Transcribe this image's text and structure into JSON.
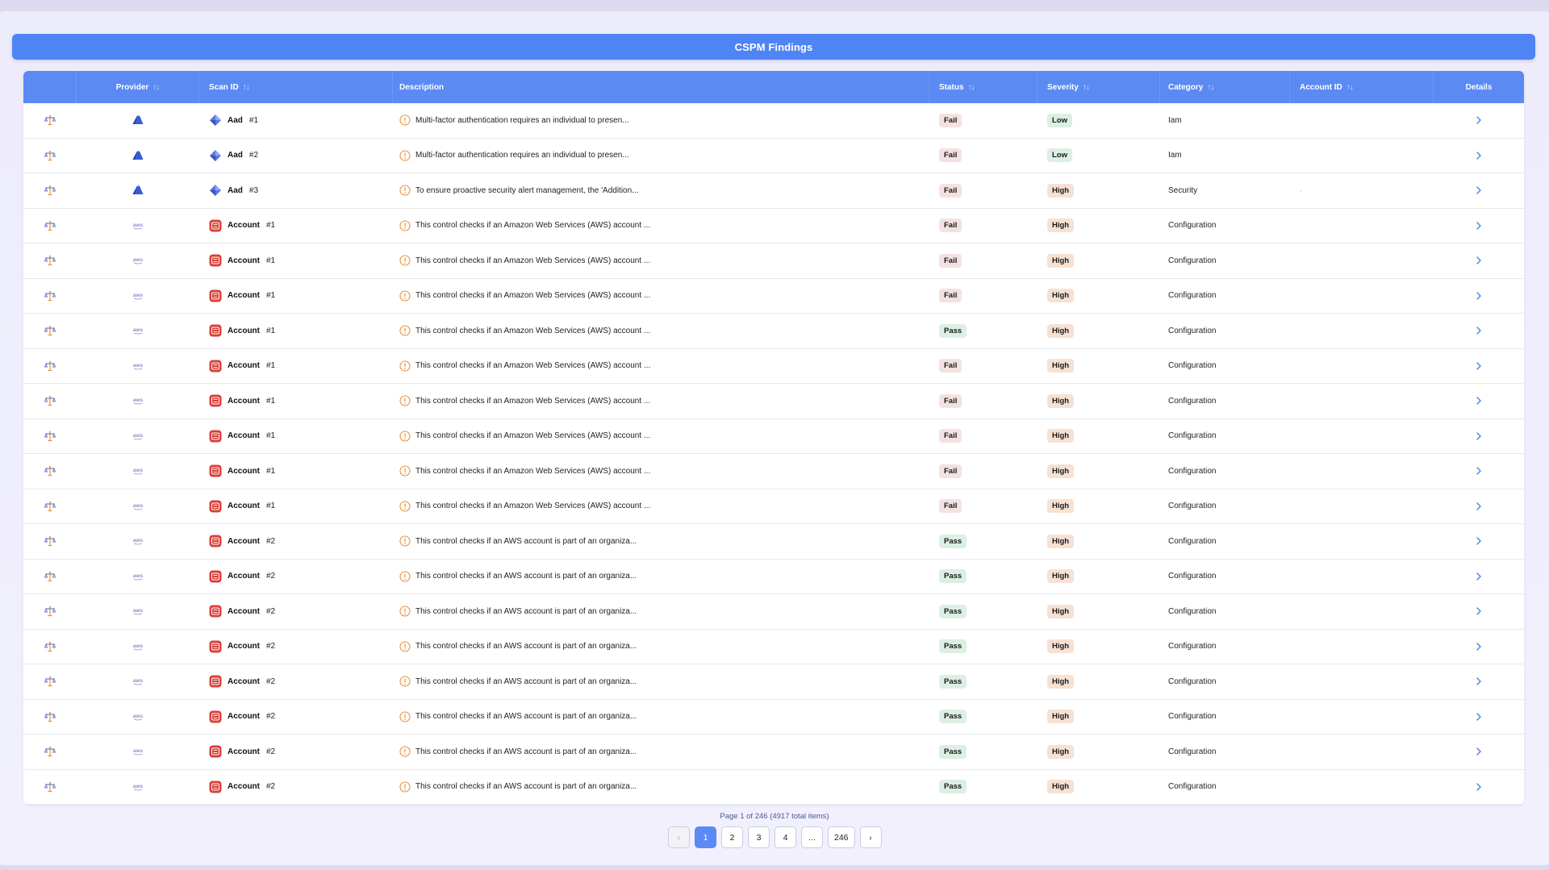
{
  "title": "CSPM Findings",
  "columns": {
    "provider": "Provider",
    "scan_id": "Scan ID",
    "description": "Description",
    "status": "Status",
    "severity": "Severity",
    "category": "Category",
    "account_id": "Account ID",
    "details": "Details"
  },
  "rows": [
    {
      "provider": "azure",
      "scan_icon": "azure",
      "scan_name": "Aad",
      "scan_num": "#1",
      "description": "Multi-factor authentication requires an individual to presen...",
      "status": "Fail",
      "severity": "Low",
      "category": "Iam",
      "account_id": ""
    },
    {
      "provider": "azure",
      "scan_icon": "azure",
      "scan_name": "Aad",
      "scan_num": "#2",
      "description": "Multi-factor authentication requires an individual to presen...",
      "status": "Fail",
      "severity": "Low",
      "category": "Iam",
      "account_id": ""
    },
    {
      "provider": "azure",
      "scan_icon": "azure",
      "scan_name": "Aad",
      "scan_num": "#3",
      "description": "To ensure proactive security alert management, the 'Addition...",
      "status": "Fail",
      "severity": "High",
      "category": "Security",
      "account_id": "-"
    },
    {
      "provider": "aws",
      "scan_icon": "aws",
      "scan_name": "Account",
      "scan_num": "#1",
      "description": "This control checks if an Amazon Web Services (AWS) account ...",
      "status": "Fail",
      "severity": "High",
      "category": "Configuration",
      "account_id": ""
    },
    {
      "provider": "aws",
      "scan_icon": "aws",
      "scan_name": "Account",
      "scan_num": "#1",
      "description": "This control checks if an Amazon Web Services (AWS) account ...",
      "status": "Fail",
      "severity": "High",
      "category": "Configuration",
      "account_id": ""
    },
    {
      "provider": "aws",
      "scan_icon": "aws",
      "scan_name": "Account",
      "scan_num": "#1",
      "description": "This control checks if an Amazon Web Services (AWS) account ...",
      "status": "Fail",
      "severity": "High",
      "category": "Configuration",
      "account_id": ""
    },
    {
      "provider": "aws",
      "scan_icon": "aws",
      "scan_name": "Account",
      "scan_num": "#1",
      "description": "This control checks if an Amazon Web Services (AWS) account ...",
      "status": "Pass",
      "severity": "High",
      "category": "Configuration",
      "account_id": ""
    },
    {
      "provider": "aws",
      "scan_icon": "aws",
      "scan_name": "Account",
      "scan_num": "#1",
      "description": "This control checks if an Amazon Web Services (AWS) account ...",
      "status": "Fail",
      "severity": "High",
      "category": "Configuration",
      "account_id": ""
    },
    {
      "provider": "aws",
      "scan_icon": "aws",
      "scan_name": "Account",
      "scan_num": "#1",
      "description": "This control checks if an Amazon Web Services (AWS) account ...",
      "status": "Fail",
      "severity": "High",
      "category": "Configuration",
      "account_id": ""
    },
    {
      "provider": "aws",
      "scan_icon": "aws",
      "scan_name": "Account",
      "scan_num": "#1",
      "description": "This control checks if an Amazon Web Services (AWS) account ...",
      "status": "Fail",
      "severity": "High",
      "category": "Configuration",
      "account_id": ""
    },
    {
      "provider": "aws",
      "scan_icon": "aws",
      "scan_name": "Account",
      "scan_num": "#1",
      "description": "This control checks if an Amazon Web Services (AWS) account ...",
      "status": "Fail",
      "severity": "High",
      "category": "Configuration",
      "account_id": ""
    },
    {
      "provider": "aws",
      "scan_icon": "aws",
      "scan_name": "Account",
      "scan_num": "#1",
      "description": "This control checks if an Amazon Web Services (AWS) account ...",
      "status": "Fail",
      "severity": "High",
      "category": "Configuration",
      "account_id": ""
    },
    {
      "provider": "aws",
      "scan_icon": "aws",
      "scan_name": "Account",
      "scan_num": "#2",
      "description": "This control checks if an AWS account is part of an organiza...",
      "status": "Pass",
      "severity": "High",
      "category": "Configuration",
      "account_id": ""
    },
    {
      "provider": "aws",
      "scan_icon": "aws",
      "scan_name": "Account",
      "scan_num": "#2",
      "description": "This control checks if an AWS account is part of an organiza...",
      "status": "Pass",
      "severity": "High",
      "category": "Configuration",
      "account_id": ""
    },
    {
      "provider": "aws",
      "scan_icon": "aws",
      "scan_name": "Account",
      "scan_num": "#2",
      "description": "This control checks if an AWS account is part of an organiza...",
      "status": "Pass",
      "severity": "High",
      "category": "Configuration",
      "account_id": ""
    },
    {
      "provider": "aws",
      "scan_icon": "aws",
      "scan_name": "Account",
      "scan_num": "#2",
      "description": "This control checks if an AWS account is part of an organiza...",
      "status": "Pass",
      "severity": "High",
      "category": "Configuration",
      "account_id": ""
    },
    {
      "provider": "aws",
      "scan_icon": "aws",
      "scan_name": "Account",
      "scan_num": "#2",
      "description": "This control checks if an AWS account is part of an organiza...",
      "status": "Pass",
      "severity": "High",
      "category": "Configuration",
      "account_id": ""
    },
    {
      "provider": "aws",
      "scan_icon": "aws",
      "scan_name": "Account",
      "scan_num": "#2",
      "description": "This control checks if an AWS account is part of an organiza...",
      "status": "Pass",
      "severity": "High",
      "category": "Configuration",
      "account_id": ""
    },
    {
      "provider": "aws",
      "scan_icon": "aws",
      "scan_name": "Account",
      "scan_num": "#2",
      "description": "This control checks if an AWS account is part of an organiza...",
      "status": "Pass",
      "severity": "High",
      "category": "Configuration",
      "account_id": ""
    },
    {
      "provider": "aws",
      "scan_icon": "aws",
      "scan_name": "Account",
      "scan_num": "#2",
      "description": "This control checks if an AWS account is part of an organiza...",
      "status": "Pass",
      "severity": "High",
      "category": "Configuration",
      "account_id": ""
    }
  ],
  "pagination": {
    "info": "Page 1 of 246 (4917 total items)",
    "prev": "‹",
    "next": "›",
    "pages": [
      "1",
      "2",
      "3",
      "4",
      "...",
      "246"
    ],
    "current": "1"
  },
  "colors": {
    "accent": "#5b8af3",
    "title_bar": "#4f84f5",
    "fail_bg": "#f4e2e1",
    "pass_bg": "#dcefe3",
    "high_bg": "#f6e1d3",
    "low_bg": "#dcefe3",
    "info_icon": "#e8923a",
    "aws_red": "#d9413a",
    "azure_blue": "#3b5bd6"
  }
}
